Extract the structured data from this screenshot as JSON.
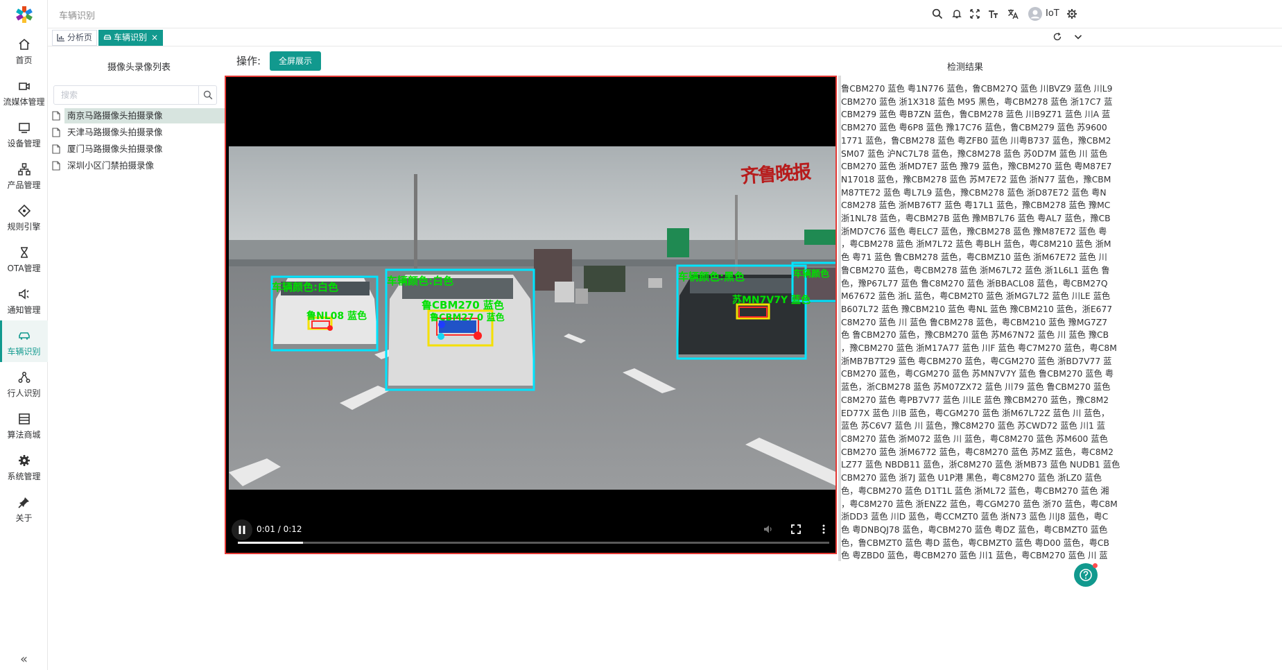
{
  "app": {
    "breadcrumb": "车辆识别",
    "user_name": "IoT"
  },
  "sidebar": {
    "items": [
      {
        "label": "首页",
        "icon": "home-icon"
      },
      {
        "label": "流媒体管理",
        "icon": "camera-icon"
      },
      {
        "label": "设备管理",
        "icon": "monitor-icon"
      },
      {
        "label": "产品管理",
        "icon": "sitemap-icon"
      },
      {
        "label": "规则引擎",
        "icon": "diamond-icon"
      },
      {
        "label": "OTA管理",
        "icon": "hourglass-icon"
      },
      {
        "label": "通知管理",
        "icon": "speaker-icon"
      },
      {
        "label": "车辆识别",
        "icon": "car-icon"
      },
      {
        "label": "行人识别",
        "icon": "share-icon"
      },
      {
        "label": "算法商城",
        "icon": "store-icon"
      },
      {
        "label": "系统管理",
        "icon": "gear-icon"
      },
      {
        "label": "关于",
        "icon": "pin-icon"
      }
    ],
    "active_index": 7,
    "collapse_glyph": "«"
  },
  "tabs": [
    {
      "label": "分析页",
      "icon": "chart-icon",
      "active": false
    },
    {
      "label": "车辆识别",
      "icon": "car-icon",
      "active": true,
      "close": "×"
    }
  ],
  "left_panel": {
    "title": "摄像头录像列表",
    "search_placeholder": "搜索",
    "files": [
      "南京马路摄像头拍摄录像",
      "天津马路摄像头拍摄录像",
      "厦门马路摄像头拍摄录像",
      "深圳小区门禁拍摄录像"
    ],
    "selected_index": 0
  },
  "operations": {
    "label": "操作:",
    "fullscreen_button": "全屏展示"
  },
  "video": {
    "current_time": "0:01",
    "duration": "0:12",
    "time_display": "0:01 / 0:12",
    "progress": 0.11,
    "watermark": "齐鲁晚报",
    "detections": [
      {
        "label": "车辆颜色:白色",
        "plate": "鲁NL08 蓝色"
      },
      {
        "label": "车辆颜色:白色",
        "plate": "鲁CBM270 蓝色",
        "plate2": "鲁CBM27 0 蓝色"
      },
      {
        "label": "车辆颜色:黑色",
        "plate": "苏MN7V7Y 蓝色"
      },
      {
        "label": "车辆颜色"
      }
    ]
  },
  "results": {
    "title": "检测结果",
    "lines": [
      "鲁CBM270 蓝色 粤1N776 蓝色，鲁CBM27Q 蓝色 川BVZ9 蓝色 川L9",
      "CBM270 蓝色 浙1X318 蓝色 M95 黑色，粤CBM278 蓝色 浙17C7 蓝",
      "CBM279 蓝色 粤B7ZN 蓝色，鲁CBM278 蓝色 川B9Z71 蓝色 川A 蓝",
      "CBM270 蓝色 粤6P8 蓝色 豫17C76 蓝色，鲁CBM279 蓝色 苏9600 ",
      "1771 蓝色，鲁CBM278 蓝色 粤ZFB0 蓝色 川粤B737 蓝色，豫CBM2",
      "SM07 蓝色 沪NC7L78 蓝色，豫C8M278 蓝色 苏0D7M 蓝色 川 蓝色",
      "CBM270 蓝色 浙MD7E7 蓝色 豫79 蓝色，豫CBM270 蓝色 粤M87E7",
      "N17018 蓝色，豫CBM278 蓝色 苏M7E72 蓝色 浙N77 蓝色，豫CBM",
      "M87TE72 蓝色 粤L7L9 蓝色，豫CBM278 蓝色 浙D87E72 蓝色 粤N ",
      "C8M278 蓝色 浙MB76T7 蓝色 粤17L1 蓝色，豫CBM278 蓝色 豫MC",
      "浙1NL78 蓝色，粤CBM27B 蓝色 豫MB7L76 蓝色 粤AL7 蓝色，豫CB",
      "浙MD7C76 蓝色 粤ELC7 蓝色，豫CBM278 蓝色 豫M87E72 蓝色 粤",
      "，粤CBM278 蓝色 浙M7L72 蓝色 粤BLH 蓝色，粤C8M210 蓝色 浙M",
      "色 粤71 蓝色 鲁CBM278 蓝色，粤CBMZ10 蓝色 浙M67E72 蓝色 川",
      "鲁CBM270 蓝色，粤CBM278 蓝色 浙M67L72 蓝色 浙1L6L1 蓝色 鲁",
      "色，豫P67L77 蓝色 鲁C8M270 蓝色 浙BBACL08 蓝色，粤CBM27Q ",
      "M67672 蓝色 浙L 蓝色，粤CBM2T0 蓝色 浙MG7L72 蓝色 川LE 蓝色",
      "B607L72 蓝色 豫CBM210 蓝色 粤NL 蓝色 豫CBM210 蓝色，浙E677",
      "C8M270 蓝色 川 蓝色 鲁CBM278 蓝色，粤CBM210 蓝色 豫MG7Z7 ",
      "色 鲁CBM270 蓝色，豫CBM270 蓝色 苏M67N72 蓝色 川 蓝色 豫CB",
      "，豫CBM270 蓝色 浙M17A77 蓝色 川F 蓝色 粤C7M270 蓝色，粤C8M",
      "浙MB7B7T29 蓝色 粤CBM270 蓝色，粤CGM270 蓝色 浙BD7V77 蓝",
      "CBM270 蓝色，粤CGM270 蓝色 苏MN7V7Y 蓝色 鲁CBM270 蓝色 粤",
      "蓝色，浙CBM278 蓝色 苏M07ZX72 蓝色 川79 蓝色 鲁CBM270 蓝色",
      "C8M270 蓝色 粤PB7V77 蓝色 川LE 蓝色 豫CBM270 蓝色，豫C8M2",
      "ED77X 蓝色 川B 蓝色，粤CGM270 蓝色 浙M67L72Z 蓝色 川 蓝色，",
      "蓝色 苏C6V7 蓝色 川 蓝色，豫C8M270 蓝色 苏CWD72 蓝色 川1 蓝",
      "C8M270 蓝色 浙M072 蓝色 川 蓝色，粤C8M270 蓝色 苏M600 蓝色",
      "CBM270 蓝色 浙M6772 蓝色，粤C8M270 蓝色 苏MZ 蓝色，粤C8M2",
      "LZ77 蓝色 NBDB11 蓝色，浙C8M270 蓝色 浙MB73 蓝色 NUDB1 蓝色",
      "CBM270 蓝色 浙7J 蓝色 U1P港 黑色，粤C8M270 蓝色 浙LZ0 蓝色 ",
      "色，粤CBM270 蓝色 D1T1L 蓝色 浙ML72 蓝色，粤CBM270 蓝色 湘",
      "，粤C8M270 蓝色 浙ENZ2 蓝色，粤CGM270 蓝色 浙70 蓝色，粤C8M",
      "浙DD3 蓝色 川D 蓝色，粤CCMZT0 蓝色 浙N73 蓝色 川J8 蓝色，粤C",
      "色 粤DNBQJ78 蓝色，粤CBM270 蓝色 粤DZ 蓝色，粤CBMZT0 蓝色",
      "色，鲁CBMZT0 蓝色 粤D 蓝色，粤CBMZT0 蓝色 粤D00 蓝色，粤CB",
      "色 粤ZBD0 蓝色，粤CBM270 蓝色 川1 蓝色，粤CBM270 蓝色 川 蓝"
    ]
  },
  "colors": {
    "accent": "#11998e",
    "video_border": "#e53935",
    "detection_box": "#00e5ff",
    "detection_text": "#00e000",
    "plate_box": "#f5e000"
  }
}
